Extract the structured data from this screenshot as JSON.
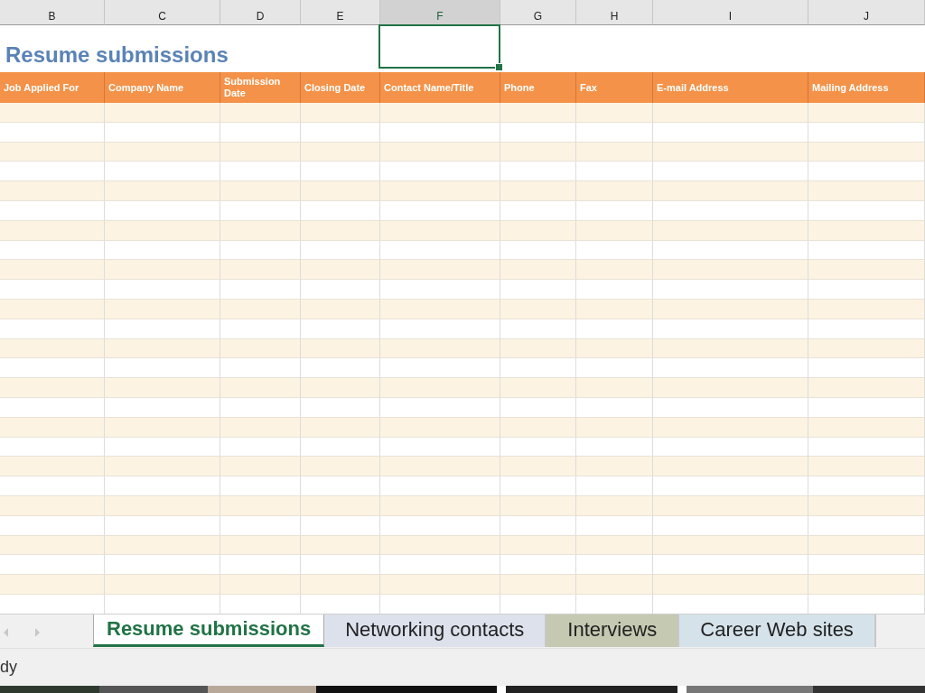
{
  "columns": [
    {
      "label": "B",
      "selected": false
    },
    {
      "label": "C",
      "selected": false
    },
    {
      "label": "D",
      "selected": false
    },
    {
      "label": "E",
      "selected": false
    },
    {
      "label": "F",
      "selected": true
    },
    {
      "label": "G",
      "selected": false
    },
    {
      "label": "H",
      "selected": false
    },
    {
      "label": "I",
      "selected": false
    },
    {
      "label": "J",
      "selected": false
    }
  ],
  "sheet_title": "Resume submissions",
  "table": {
    "headers": [
      "Job Applied For",
      "Company Name",
      "Submission Date",
      "Closing Date",
      "Contact Name/Title",
      "Phone",
      "Fax",
      "E-mail Address",
      "Mailing Address"
    ]
  },
  "sheet_tabs": [
    {
      "label": "Resume submissions",
      "selected": true,
      "color": "#ffffff"
    },
    {
      "label": "Networking contacts",
      "selected": false,
      "color": "#dce1ec"
    },
    {
      "label": "Interviews",
      "selected": false,
      "color": "#c5c9b1"
    },
    {
      "label": "Career Web sites",
      "selected": false,
      "color": "#d5e2ea"
    }
  ],
  "status_bar": {
    "text": "dy"
  }
}
